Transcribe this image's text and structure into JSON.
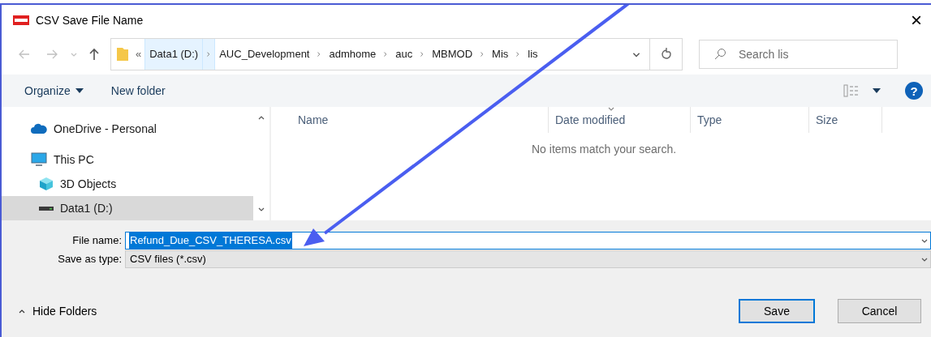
{
  "window": {
    "title": "CSV Save File Name",
    "close": "×"
  },
  "address_bar": {
    "overflow": "«",
    "crumbs": [
      {
        "label": "Data1 (D:)",
        "hovered": true
      },
      {
        "label": "AUC_Development",
        "hovered": false
      },
      {
        "label": "admhome",
        "hovered": false
      },
      {
        "label": "auc",
        "hovered": false
      },
      {
        "label": "MBMOD",
        "hovered": false
      },
      {
        "label": "Mis",
        "hovered": false
      },
      {
        "label": "lis",
        "hovered": false
      }
    ]
  },
  "search": {
    "placeholder": "Search lis"
  },
  "toolbar": {
    "organize": "Organize",
    "new_folder": "New folder",
    "help": "?"
  },
  "navigation": [
    {
      "label": "OneDrive - Personal",
      "kind": "cloud",
      "selected": false
    },
    {
      "label": "This PC",
      "kind": "pc",
      "selected": false,
      "children": [
        {
          "label": "3D Objects",
          "kind": "cube",
          "selected": false
        },
        {
          "label": "Data1 (D:)",
          "kind": "drive",
          "selected": true
        }
      ]
    }
  ],
  "columns": [
    "Name",
    "Date modified",
    "Type",
    "Size"
  ],
  "empty_message": "No items match your search.",
  "file_name": {
    "label": "File name:",
    "value": "Refund_Due_CSV_THERESA.csv"
  },
  "save_as_type": {
    "label": "Save as type:",
    "value": "CSV files (*.csv)"
  },
  "hide_folders": "Hide Folders",
  "buttons": [
    {
      "label": "Save",
      "default": true
    },
    {
      "label": "Cancel",
      "default": false
    }
  ]
}
